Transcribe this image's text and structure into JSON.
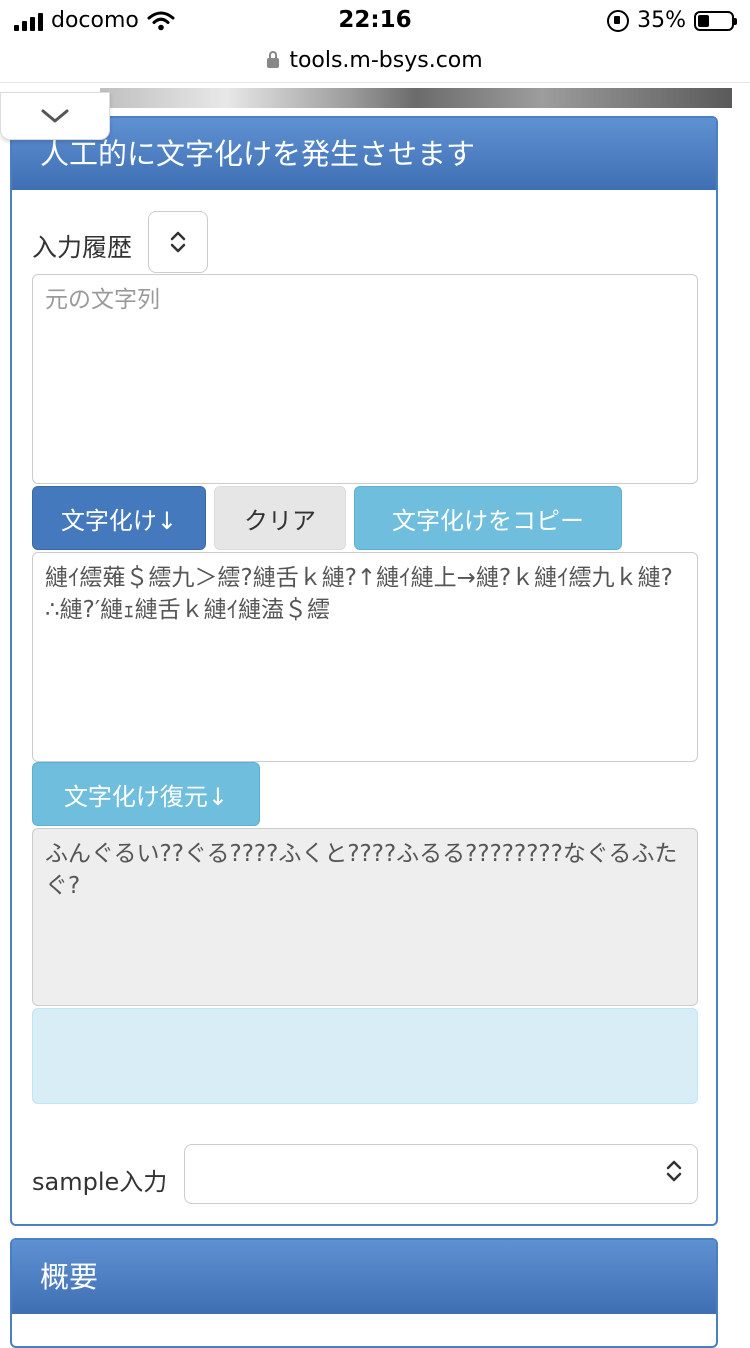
{
  "status_bar": {
    "carrier": "docomo",
    "time": "22:16",
    "battery": "35%",
    "battery_level": 0.35
  },
  "browser": {
    "url": "tools.m-bsys.com"
  },
  "main_panel": {
    "title": "人工的に文字化けを発生させます",
    "history_label": "入力履歴",
    "source_placeholder": "元の文字列",
    "garble_button": "文字化け↓",
    "clear_button": "クリア",
    "copy_button": "文字化けをコピー",
    "garbled_text": "縺ｲ繧薙＄繧九＞繧?縺舌ｋ縺?↑縺ｲ縺上→縺?ｋ縺ｲ繧九ｋ縺?∴縺?′縺ｪ縺舌ｋ縺ｲ縺溘＄繧",
    "restore_button": "文字化け復元↓",
    "restored_text": "ふんぐるい??ぐる????ふくと????ふるる????????なぐるふたぐ?",
    "sample_label": "sample入力",
    "sample_value": ""
  },
  "overview_panel": {
    "title": "概要"
  }
}
